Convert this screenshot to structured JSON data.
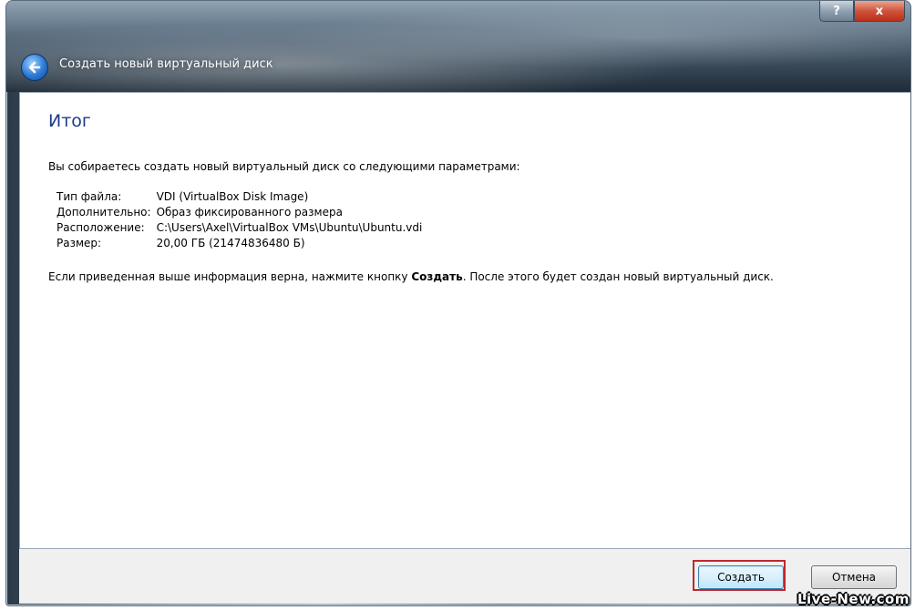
{
  "window": {
    "title": "Создать новый виртуальный диск",
    "help_label": "?",
    "close_label": "x"
  },
  "page": {
    "heading": "Итог",
    "intro": "Вы собираетесь создать новый виртуальный диск со следующими параметрами:",
    "params": [
      {
        "key": "Тип файла:",
        "value": "VDI (VirtualBox Disk Image)"
      },
      {
        "key": "Дополнительно:",
        "value": "Образ фиксированного размера"
      },
      {
        "key": "Расположение:",
        "value": "C:\\Users\\Axel\\VirtualBox VMs\\Ubuntu\\Ubuntu.vdi"
      },
      {
        "key": "Размер:",
        "value": "20,00 ГБ (21474836480 Б)"
      }
    ],
    "note_before": "Если приведенная выше информация верна, нажмите кнопку ",
    "note_bold": "Создать",
    "note_after": ". После этого будет создан новый виртуальный диск."
  },
  "footer": {
    "create_label": "Создать",
    "cancel_label": "Отмена"
  },
  "watermark": "Live-New.com",
  "colors": {
    "heading": "#1e3b8a",
    "highlight": "#c0272d"
  }
}
